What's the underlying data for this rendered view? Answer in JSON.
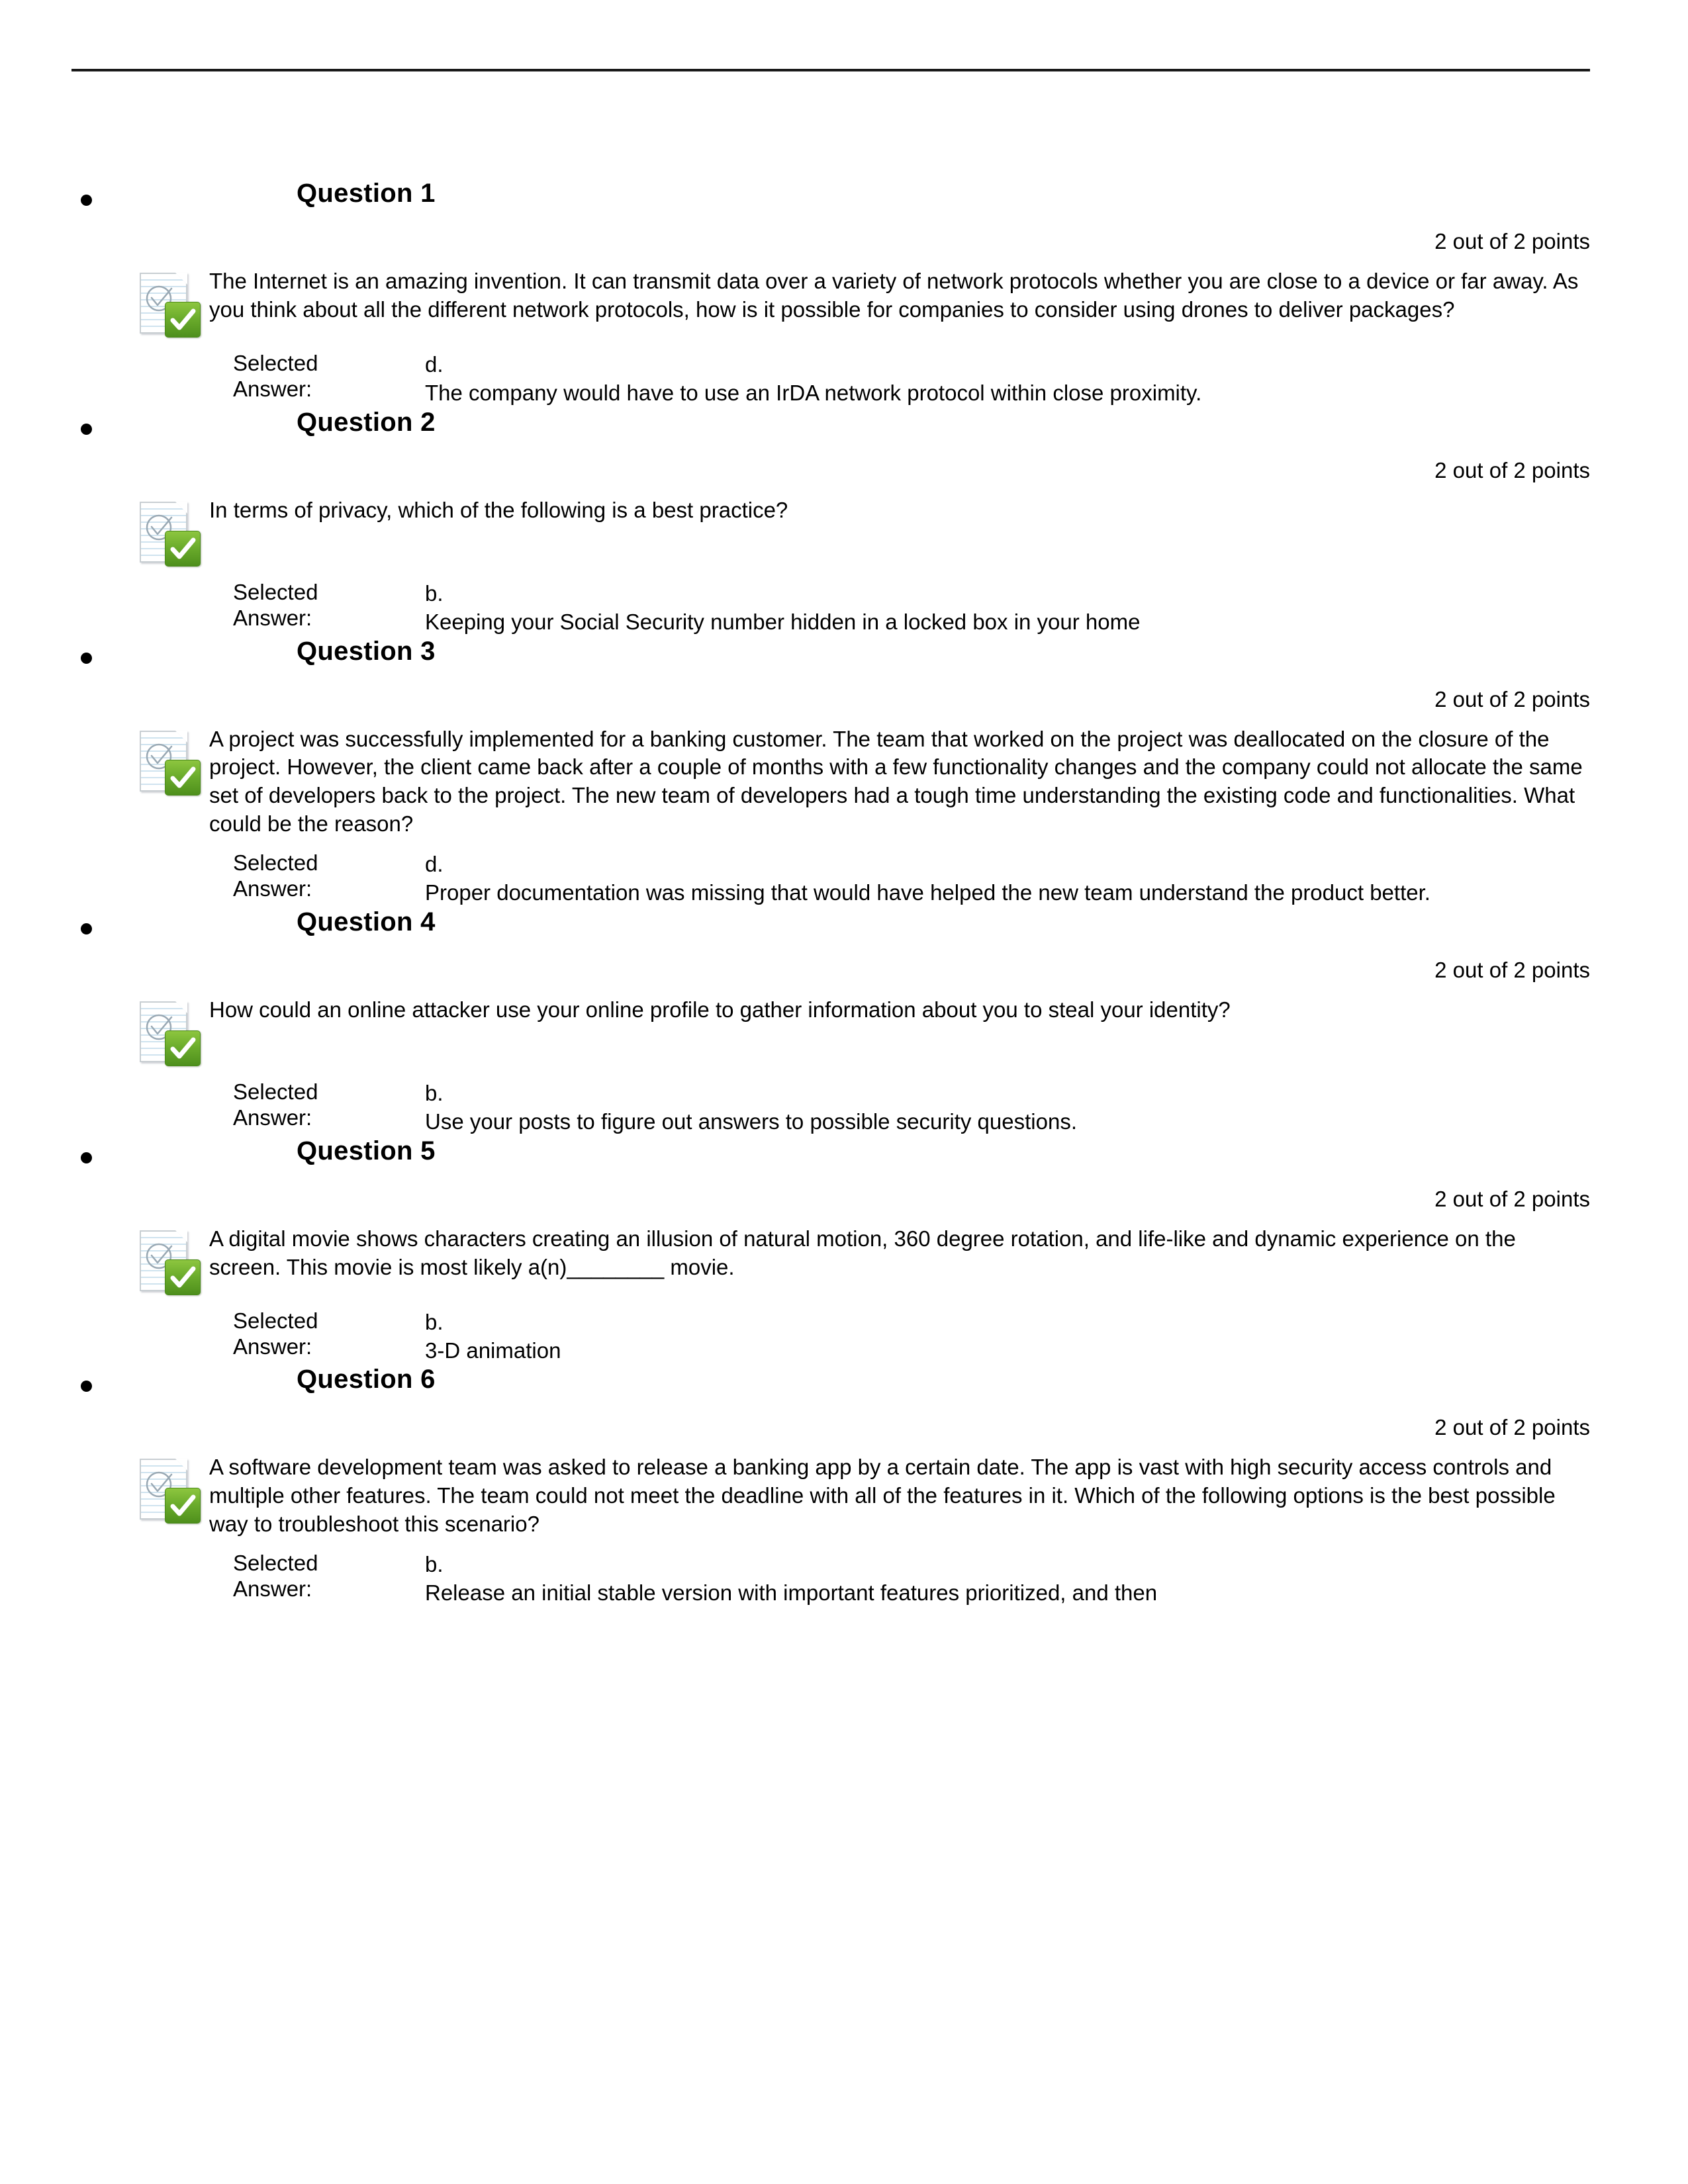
{
  "document": {
    "type": "quiz-results",
    "selected_answer_label": "Selected\nAnswer:",
    "selected_label_line1": "Selected",
    "selected_label_line2": "Answer:",
    "icon_name": "graded-question-checkmark-icon"
  },
  "questions": [
    {
      "title": "Question 1",
      "points": "2 out of 2 points",
      "text": "The Internet is an amazing invention. It can transmit data over a variety of network protocols whether you are close to a device or far away. As you think about all the different network protocols, how is it possible for companies to consider using drones to deliver packages?",
      "answer_letter": "d.",
      "answer_text": "The company would have to use an IrDA network protocol within close proximity."
    },
    {
      "title": "Question 2",
      "points": "2 out of 2 points",
      "text": "In terms of privacy, which of the following is a best practice?",
      "answer_letter": "b.",
      "answer_text": "Keeping your Social Security number hidden in a locked box in your home"
    },
    {
      "title": "Question 3",
      "points": "2 out of 2 points",
      "text": "A project was successfully implemented for a banking customer. The team that worked on the project was deallocated on the closure of the project. However, the client came back after a couple of months with a few functionality changes and the company could not allocate the same set of developers back to the project. The new team of developers had a tough time understanding the existing code and functionalities. What could be the reason?",
      "answer_letter": "d.",
      "answer_text": "Proper documentation was missing that would have helped the new team understand the product better."
    },
    {
      "title": "Question 4",
      "points": "2 out of 2 points",
      "text": "How could an online attacker use your online profile to gather information about you to steal your identity?",
      "answer_letter": "b.",
      "answer_text": "Use your posts to figure out answers to possible security questions."
    },
    {
      "title": "Question 5",
      "points": "2 out of 2 points",
      "text": "A digital movie shows characters creating an illusion of natural motion, 360 degree rotation, and life-like and dynamic experience on the screen. This movie is most likely a(n)________ movie.",
      "answer_letter": "b.",
      "answer_text": "3-D animation"
    },
    {
      "title": "Question 6",
      "points": "2 out of 2 points",
      "text": "A software development team was asked to release a banking app by a certain date. The app is vast with high security access controls and multiple other features. The team could not meet the deadline with all of the features in it. Which of the following options is the best possible way to troubleshoot this scenario?",
      "answer_letter": "b.",
      "answer_text": "Release an initial stable version with important features prioritized, and then"
    }
  ],
  "colors": {
    "badge_green": "#6aab2b",
    "rule": "#1a1a1a",
    "paper_line": "#cfe3ef"
  }
}
